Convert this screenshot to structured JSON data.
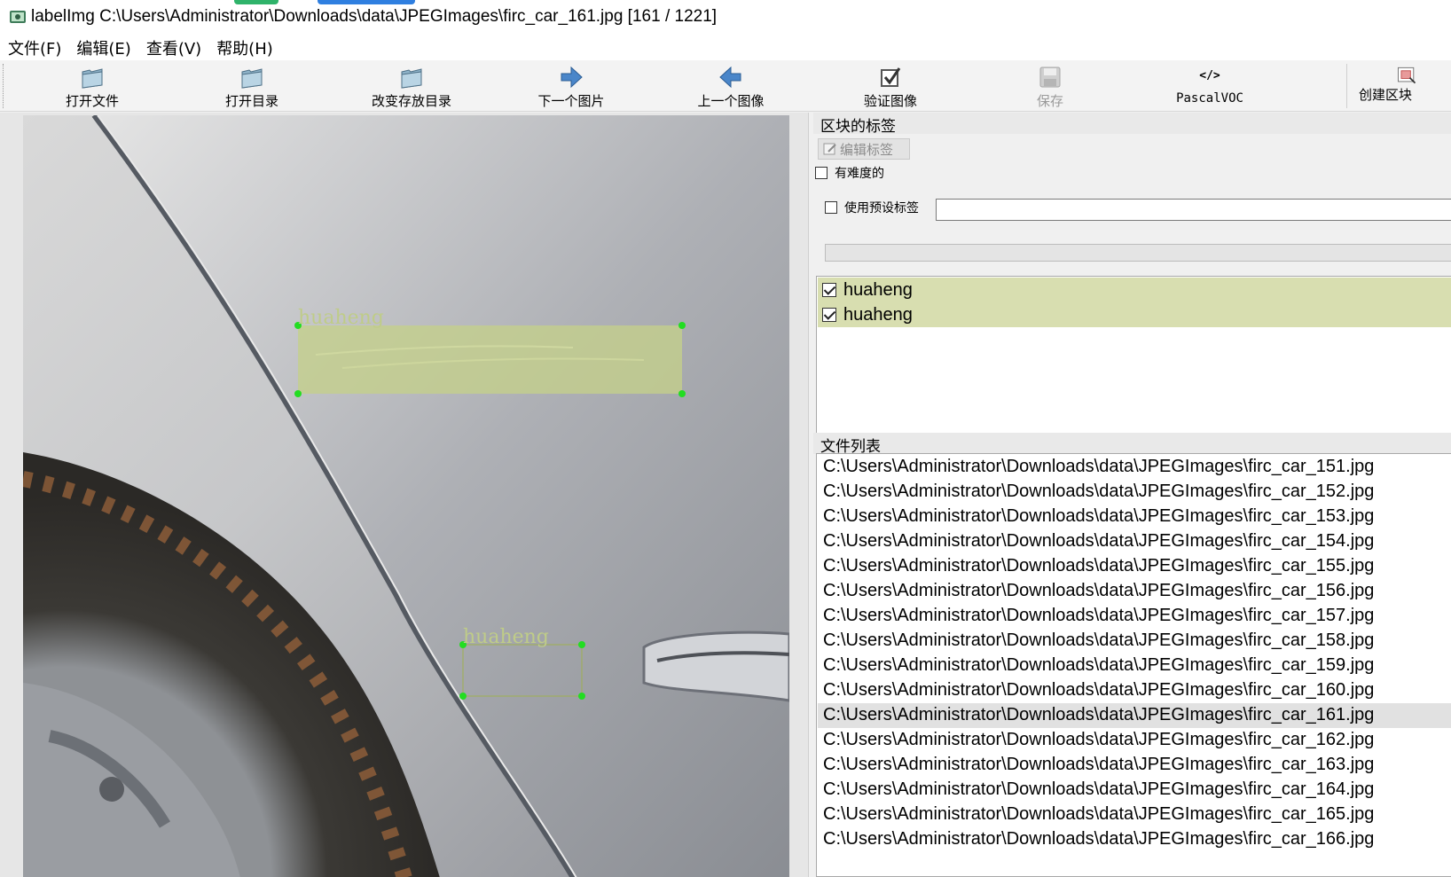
{
  "window": {
    "title": "labelImg C:\\Users\\Administrator\\Downloads\\data\\JPEGImages\\firc_car_161.jpg [161 / 1221]"
  },
  "menu": [
    "文件(F)",
    "编辑(E)",
    "查看(V)",
    "帮助(H)"
  ],
  "toolbar": {
    "open_file": "打开文件",
    "open_dir": "打开目录",
    "change_save_dir": "改变存放目录",
    "next_image": "下一个图片",
    "prev_image": "上一个图像",
    "verify_image": "验证图像",
    "save": "保存",
    "format": "PascalVOC",
    "format_icon_text": "</>",
    "create_box": "创建区块"
  },
  "canvas": {
    "boxes": [
      {
        "label": "huaheng"
      },
      {
        "label": "huaheng"
      }
    ]
  },
  "box_labels_panel": {
    "title": "区块的标签",
    "edit_label_button": "编辑标签",
    "difficult_checkbox": "有难度的",
    "use_default_label_checkbox": "使用预设标签",
    "default_label_value": "",
    "labels": [
      "huaheng",
      "huaheng"
    ]
  },
  "file_list_panel": {
    "title": "文件列表",
    "selected_index": 10,
    "files": [
      "C:\\Users\\Administrator\\Downloads\\data\\JPEGImages\\firc_car_151.jpg",
      "C:\\Users\\Administrator\\Downloads\\data\\JPEGImages\\firc_car_152.jpg",
      "C:\\Users\\Administrator\\Downloads\\data\\JPEGImages\\firc_car_153.jpg",
      "C:\\Users\\Administrator\\Downloads\\data\\JPEGImages\\firc_car_154.jpg",
      "C:\\Users\\Administrator\\Downloads\\data\\JPEGImages\\firc_car_155.jpg",
      "C:\\Users\\Administrator\\Downloads\\data\\JPEGImages\\firc_car_156.jpg",
      "C:\\Users\\Administrator\\Downloads\\data\\JPEGImages\\firc_car_157.jpg",
      "C:\\Users\\Administrator\\Downloads\\data\\JPEGImages\\firc_car_158.jpg",
      "C:\\Users\\Administrator\\Downloads\\data\\JPEGImages\\firc_car_159.jpg",
      "C:\\Users\\Administrator\\Downloads\\data\\JPEGImages\\firc_car_160.jpg",
      "C:\\Users\\Administrator\\Downloads\\data\\JPEGImages\\firc_car_161.jpg",
      "C:\\Users\\Administrator\\Downloads\\data\\JPEGImages\\firc_car_162.jpg",
      "C:\\Users\\Administrator\\Downloads\\data\\JPEGImages\\firc_car_163.jpg",
      "C:\\Users\\Administrator\\Downloads\\data\\JPEGImages\\firc_car_164.jpg",
      "C:\\Users\\Administrator\\Downloads\\data\\JPEGImages\\firc_car_165.jpg",
      "C:\\Users\\Administrator\\Downloads\\data\\JPEGImages\\firc_car_166.jpg"
    ]
  },
  "colors": {
    "label_row_bg": "#d8deb0",
    "box_fill": "#c4d08a",
    "box_vertex": "#22dd22",
    "selected_file_bg": "#e1e1e1"
  }
}
